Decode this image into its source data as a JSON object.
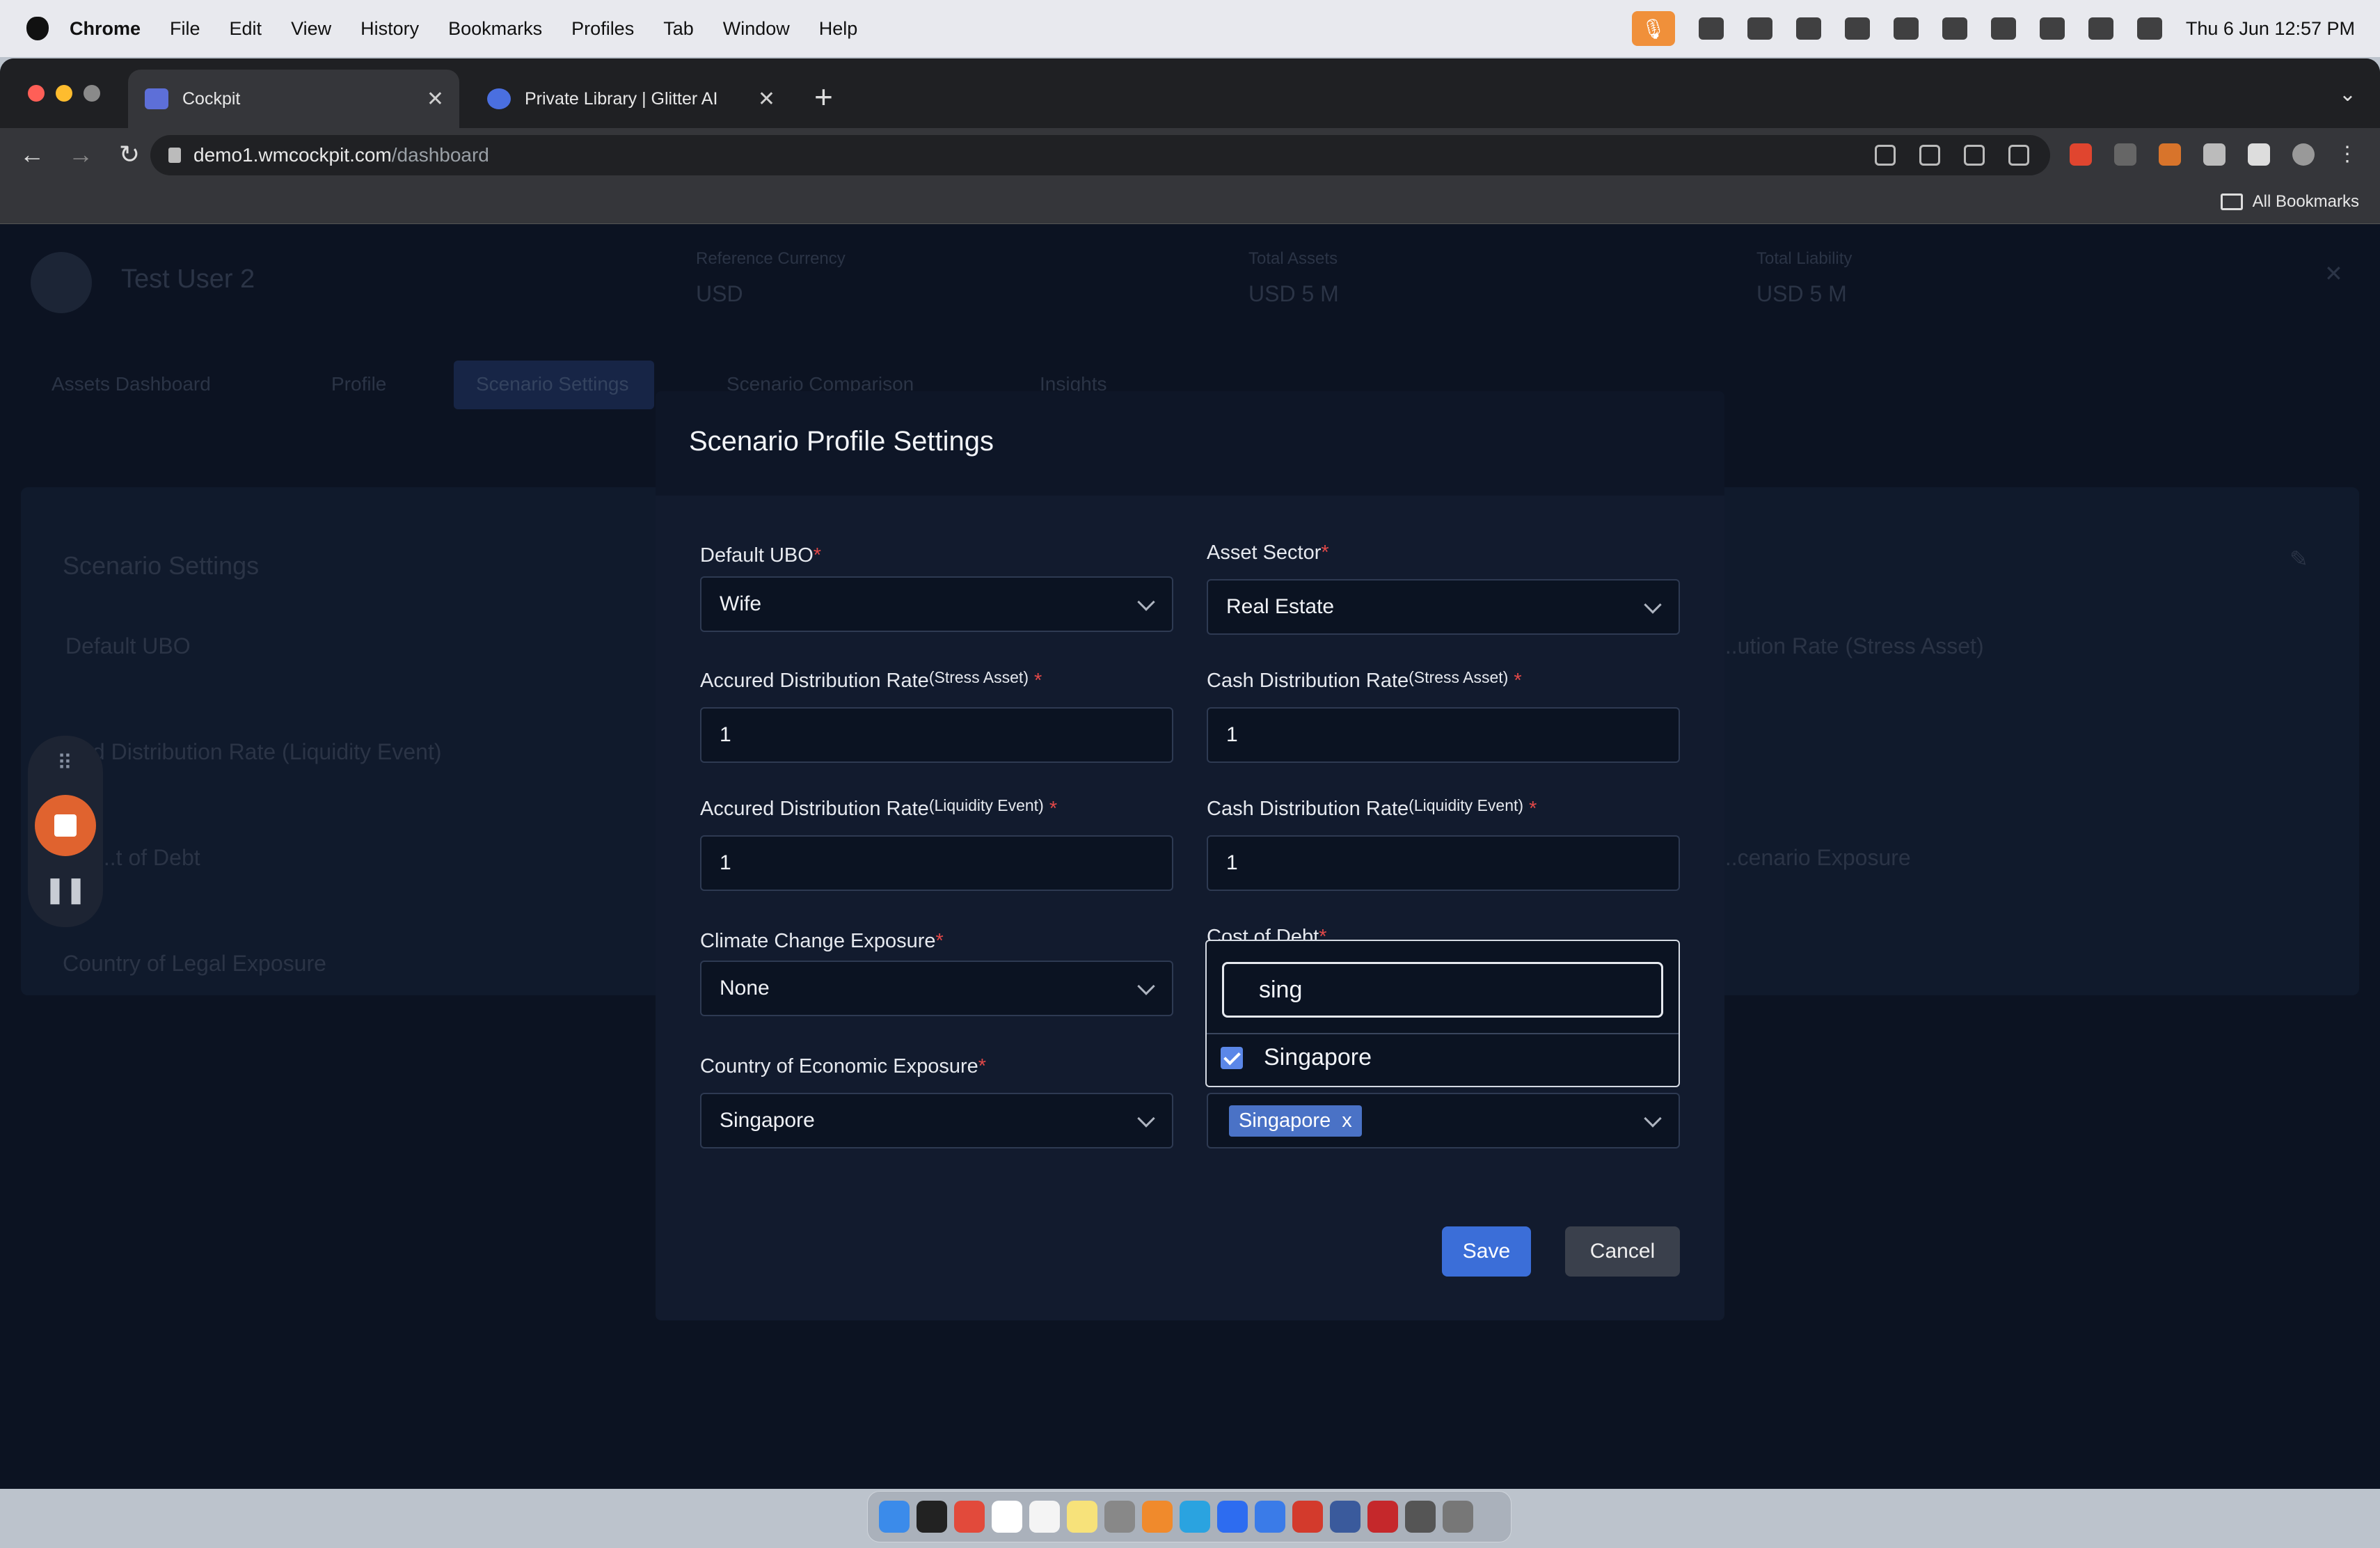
{
  "menubar": {
    "app": "Chrome",
    "items": [
      "File",
      "Edit",
      "View",
      "History",
      "Bookmarks",
      "Profiles",
      "Tab",
      "Window",
      "Help"
    ],
    "datetime": "Thu 6 Jun  12:57 PM"
  },
  "browser": {
    "tabs": [
      {
        "title": "Cockpit",
        "active": true
      },
      {
        "title": "Private Library | Glitter AI",
        "active": false
      }
    ],
    "url_host": "demo1.wmcockpit.com",
    "url_path": "/dashboard",
    "bookmarks_label": "All Bookmarks"
  },
  "background": {
    "user_name": "Test User 2",
    "summary": [
      {
        "label": "Reference Currency",
        "value": "USD"
      },
      {
        "label": "Total Assets",
        "value": "USD 5 M"
      },
      {
        "label": "Total Liability",
        "value": "USD 5 M"
      }
    ],
    "tabs": [
      "Assets Dashboard",
      "Profile",
      "Scenario Settings",
      "Scenario Comparison",
      "Insights"
    ],
    "panel_title": "Scenario Settings",
    "panel_fields": [
      "Default UBO",
      "...rued Distribution Rate (Liquidity Event)",
      "...t of Debt",
      "Country of Legal Exposure"
    ],
    "panel_fields_right": [
      "...ution Rate (Stress Asset)",
      "...cenario Exposure"
    ]
  },
  "modal": {
    "title": "Scenario Profile Settings",
    "fields": {
      "default_ubo": {
        "label": "Default UBO",
        "value": "Wife"
      },
      "asset_sector": {
        "label": "Asset Sector",
        "value": "Real Estate"
      },
      "accrued_stress": {
        "label": "Accured Distribution Rate",
        "sup": "(Stress Asset)",
        "value": "1"
      },
      "cash_stress": {
        "label": "Cash Distribution Rate",
        "sup": "(Stress Asset)",
        "value": "1"
      },
      "accrued_liquidity": {
        "label": "Accured Distribution Rate",
        "sup": "(Liquidity Event)",
        "value": "1"
      },
      "cash_liquidity": {
        "label": "Cash Distribution Rate",
        "sup": "(Liquidity Event)",
        "value": "1"
      },
      "climate": {
        "label": "Climate Change Exposure",
        "value": "None"
      },
      "cost_of_debt": {
        "label": "Cost of Debt"
      },
      "economic_exposure": {
        "label": "Country of Economic Exposure",
        "value": "Singapore"
      },
      "legal_exposure": {
        "selected_tag": "Singapore",
        "tag_remove": "x"
      }
    },
    "dropdown": {
      "search_value": "sing",
      "option": "Singapore",
      "checked": true
    },
    "save_label": "Save",
    "cancel_label": "Cancel"
  },
  "colors": {
    "accent": "#3b6ed8",
    "required": "#e04848",
    "record": "#e0632f"
  }
}
